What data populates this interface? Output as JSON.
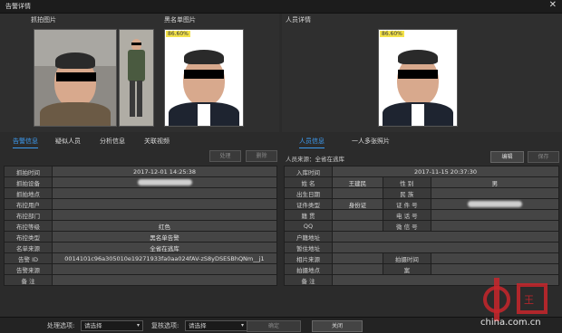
{
  "window": {
    "title": "告警详情",
    "close": "✕"
  },
  "left": {
    "capture_label": "抓拍图片",
    "blacklist_label": "黑名单图片",
    "blacklist_pct": "86.60%",
    "tabs": [
      "告警信息",
      "疑似人员",
      "分析信息",
      "关联视频"
    ],
    "btn1": "处理",
    "btn2": "删除",
    "rows": [
      {
        "l": "抓拍时间",
        "v": "2017-12-01 14:25:38"
      },
      {
        "l": "抓拍设备",
        "v": ""
      },
      {
        "l": "抓拍地点",
        "v": ""
      },
      {
        "l": "布控用户",
        "v": ""
      },
      {
        "l": "布控部门",
        "v": ""
      },
      {
        "l": "布控等级",
        "v": "红色"
      },
      {
        "l": "布控类型",
        "v": "黑名单告警"
      },
      {
        "l": "名单来源",
        "v": "全省在逃库"
      },
      {
        "l": "告警 ID",
        "v": "0014101c96a305010e19271933fa0aa024fAV-zS8yDSESBhQNm__j1"
      },
      {
        "l": "告警来源",
        "v": ""
      },
      {
        "l": "备    注",
        "v": ""
      }
    ]
  },
  "right": {
    "person_label": "人员详情",
    "pct": "86.60%",
    "tabs": [
      "人员信息",
      "一人多张照片"
    ],
    "source": "人员来源：全省在逃库",
    "edit": "编辑",
    "save": "保存",
    "entry_label": "入库时间",
    "entry_value": "2017-11-15 20:37:30",
    "rows": [
      {
        "l1": "姓    名",
        "v1": "王建民",
        "l2": "性    别",
        "v2": "男"
      },
      {
        "l1": "出生日期",
        "v1": "",
        "l2": "民    族",
        "v2": ""
      },
      {
        "l1": "证件类型",
        "v1": "身份证",
        "l2": "证 件 号",
        "v2": ""
      },
      {
        "l1": "籍    贯",
        "v1": "",
        "l2": "电 话 号",
        "v2": ""
      },
      {
        "l1": "QQ",
        "v1": "",
        "l2": "微 信 号",
        "v2": ""
      }
    ],
    "wide_rows": [
      {
        "l": "户籍地址",
        "v": ""
      },
      {
        "l": "暂住地址",
        "v": ""
      },
      {
        "l": "相片来源",
        "v": "",
        "l2": "拍摄时间",
        "v2": ""
      },
      {
        "l": "拍摄地点",
        "v": "",
        "l2": "案",
        "v2": ""
      },
      {
        "l": "备    注",
        "v": ""
      }
    ]
  },
  "footer": {
    "process_label": "处理选项:",
    "process_value": "请选择",
    "review_label": "复核选项:",
    "review_value": "请选择",
    "confirm": "确定",
    "close": "关闭"
  },
  "watermark": {
    "brand": "中国",
    "url": "china.com.cn"
  }
}
